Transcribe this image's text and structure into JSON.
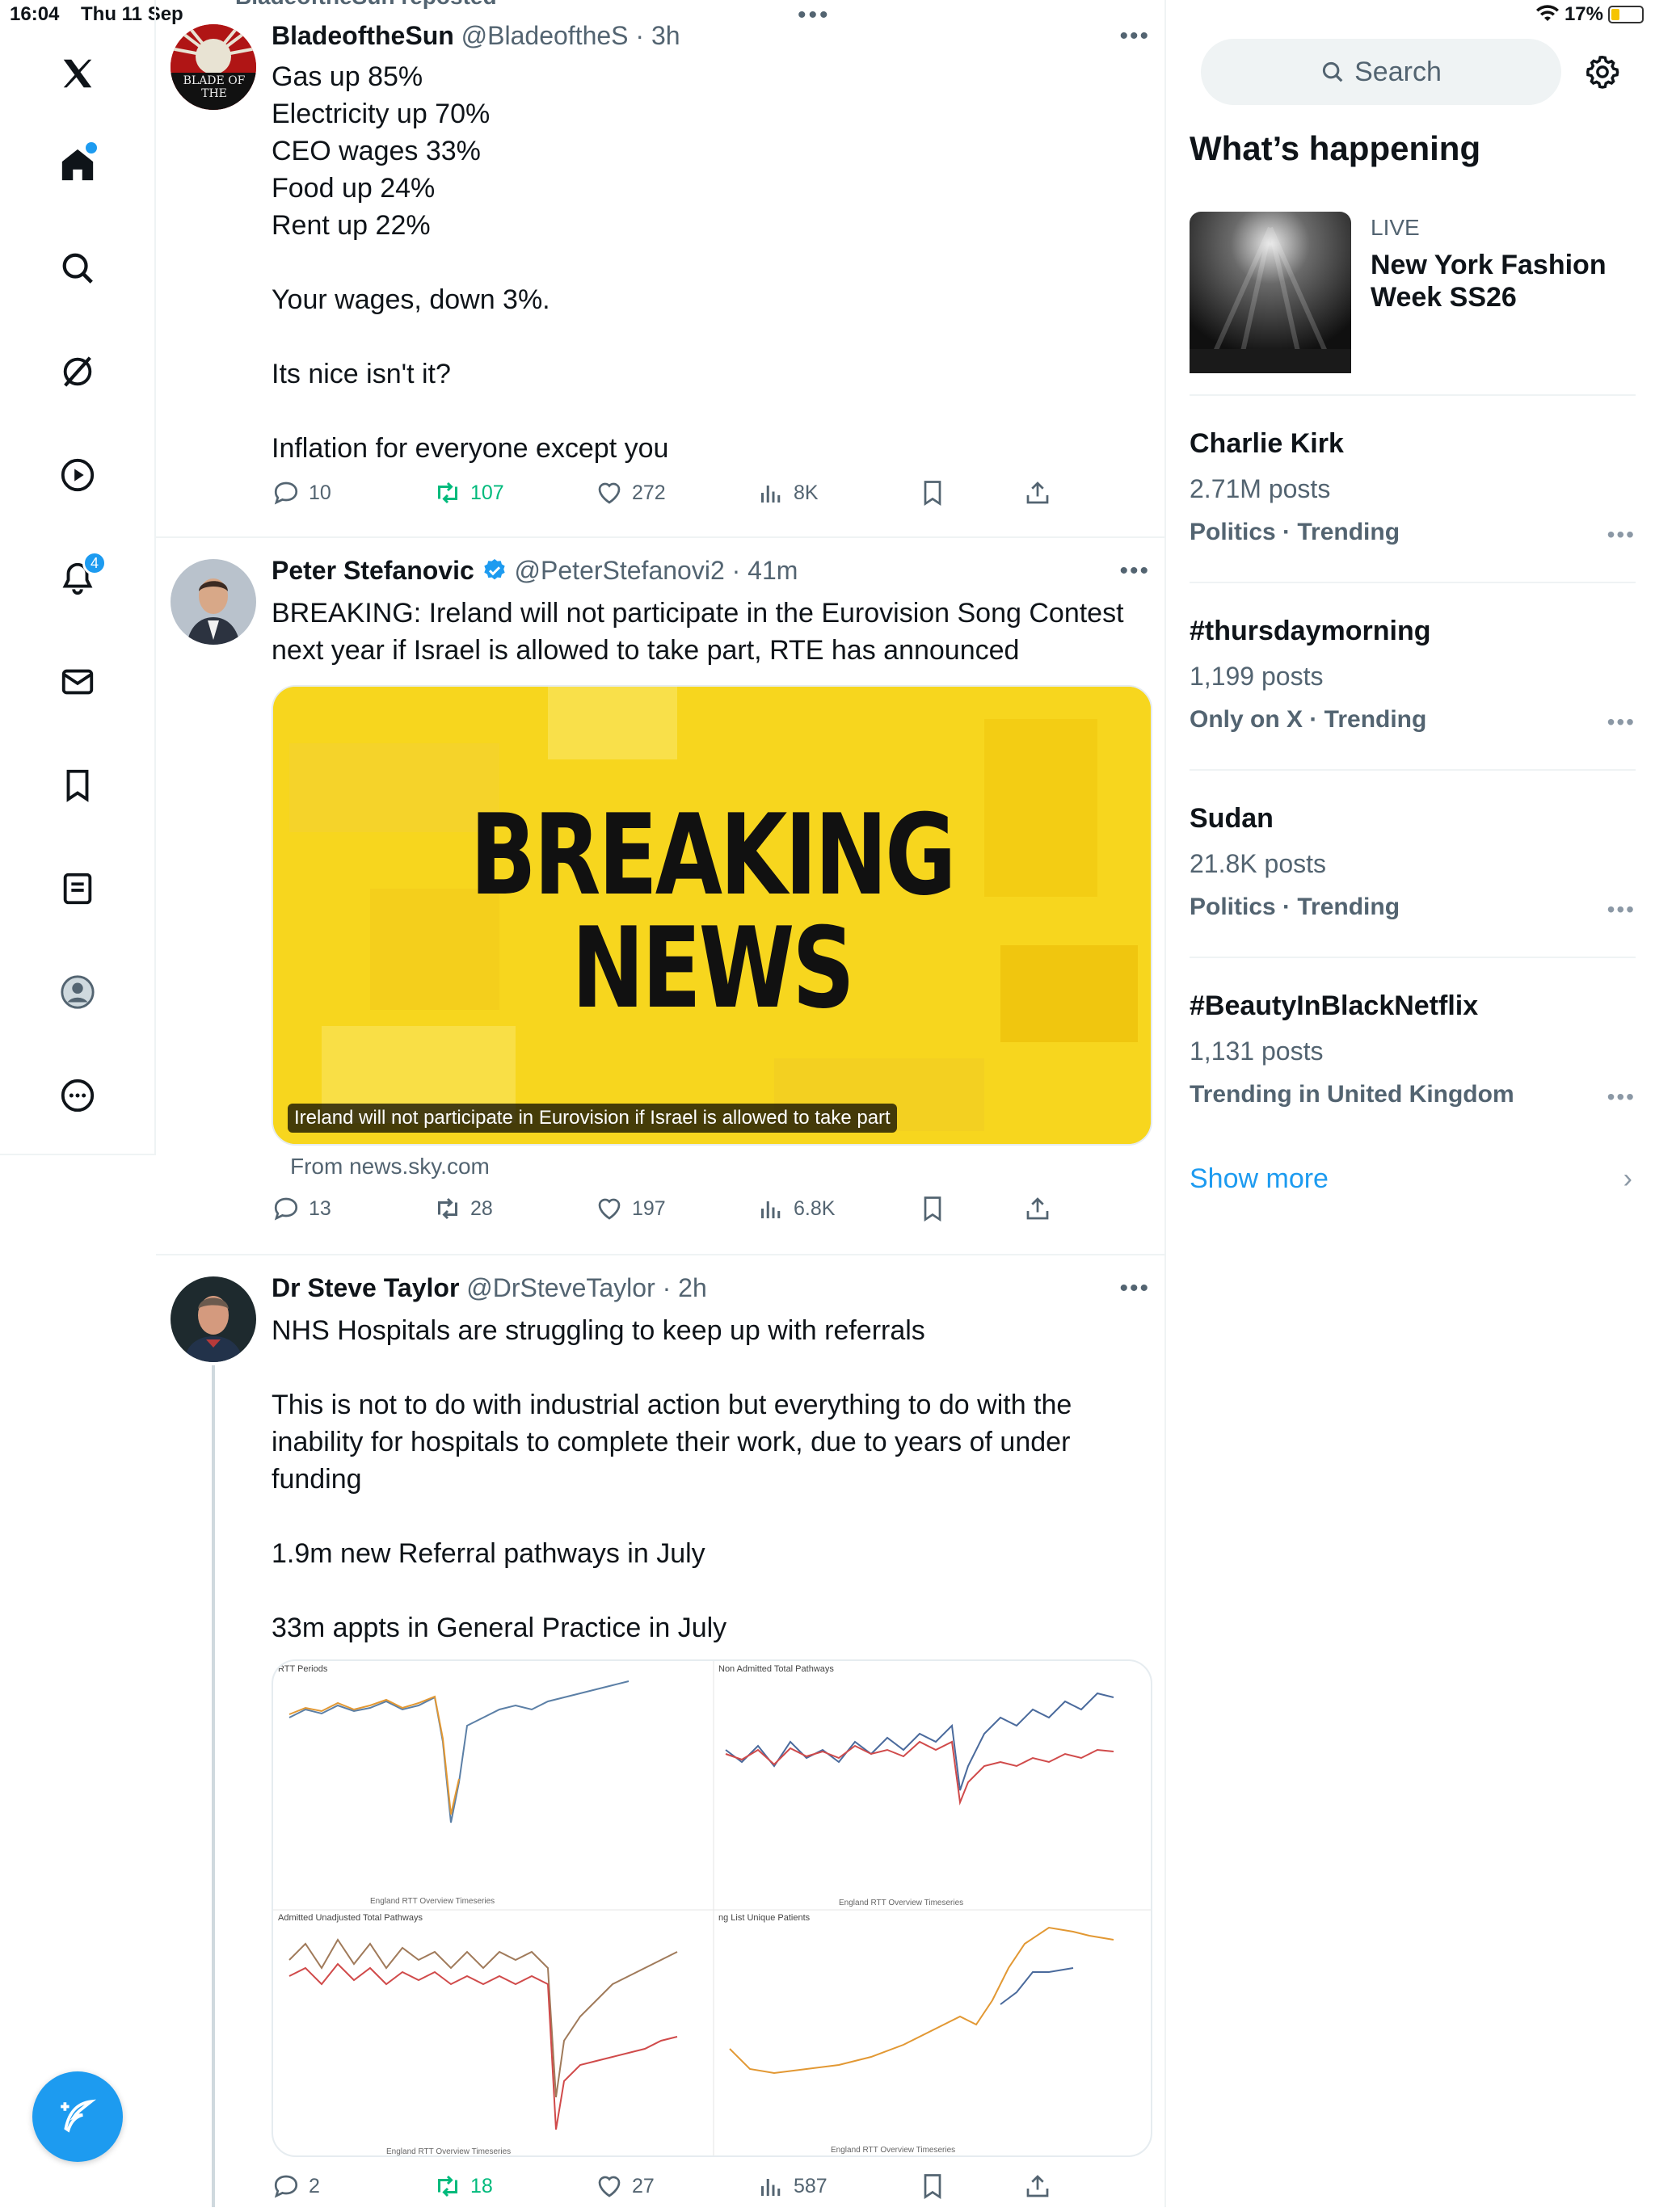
{
  "status": {
    "time": "16:04",
    "date": "Thu 11 Sep",
    "battery": "17%"
  },
  "nav": {
    "notifications_badge": "4"
  },
  "tweets": [
    {
      "reposted_by": "BladeoftheSun reposted",
      "name": "BladeoftheSun",
      "handle": "@BladeoftheS",
      "time": "· 3h",
      "avatar_text": "BLADE OF THE",
      "text": "Gas up 85%\nElectricity up 70%\nCEO wages 33%\nFood up 24%\nRent up 22%\n\nYour wages, down 3%.\n\nIts nice isn't it?\n\nInflation for everyone except you",
      "replies": "10",
      "reposts": "107",
      "likes": "272",
      "views": "8K"
    },
    {
      "name": "Peter Stefanovic",
      "handle": "@PeterStefanovi2",
      "time": "· 41m",
      "text": "BREAKING: Ireland will not participate in the Eurovision Song Contest next year if Israel is allowed to take part, RTE has announced",
      "card_headline_1": "BREAKING",
      "card_headline_2": "NEWS",
      "card_caption": "Ireland will not participate in Eurovision if Israel is allowed to take part",
      "card_source": "From news.sky.com",
      "replies": "13",
      "reposts": "28",
      "likes": "197",
      "views": "6.8K"
    },
    {
      "name": "Dr Steve Taylor",
      "handle": "@DrSteveTaylor",
      "time": "· 2h",
      "text": "NHS Hospitals are struggling to keep up with referrals\n\nThis is not to do with industrial action but everything to do with the inability for hospitals to complete their work, due to years of under funding\n\n1.9m new Referral pathways in July\n\n33m appts in General Practice in July",
      "chart_titles": [
        "RTT Periods",
        "Non Admitted Total Pathways",
        "Admitted Unadjusted Total Pathways",
        "ng List Unique Patients"
      ],
      "chart_footer": "England RTT Overview Timeseries",
      "replies": "2",
      "reposts": "18",
      "likes": "27",
      "views": "587"
    }
  ],
  "sidebar": {
    "search_placeholder": "Search",
    "title": "What’s happening",
    "live": {
      "label": "LIVE",
      "title": "New York Fashion Week SS26"
    },
    "trends": [
      {
        "name": "Charlie Kirk",
        "count": "2.71M posts",
        "category": "Politics · Trending"
      },
      {
        "name": "#thursdaymorning",
        "count": "1,199 posts",
        "category": "Only on X · Trending"
      },
      {
        "name": "Sudan",
        "count": "21.8K posts",
        "category": "Politics · Trending"
      },
      {
        "name": "#BeautyInBlackNetflix",
        "count": "1,131 posts",
        "category": "Trending in United Kingdom"
      }
    ],
    "show_more": "Show more"
  },
  "colors": {
    "accent": "#1d9bf0",
    "repost_green": "#00ba7c",
    "card_yellow": "#f7d61e"
  }
}
